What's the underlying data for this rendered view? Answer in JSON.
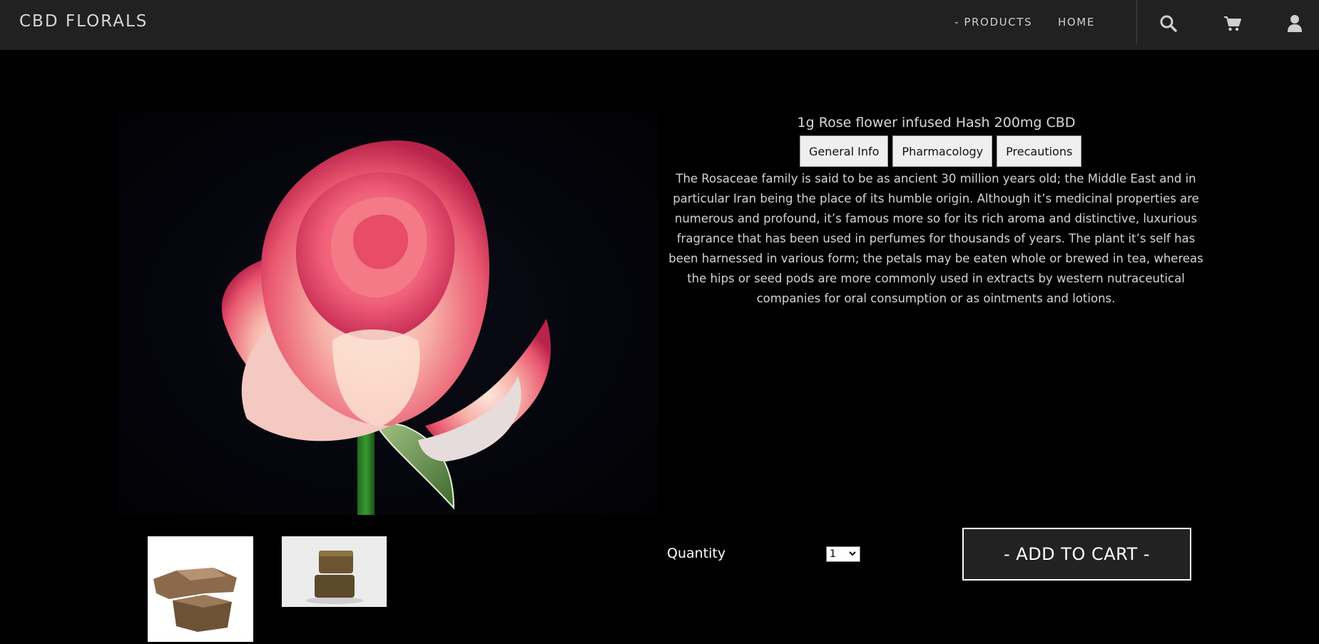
{
  "nav": {
    "brand": "CBD FLORALS",
    "products_label": "- PRODUCTS",
    "home_label": "HOME",
    "icons": [
      "search-icon",
      "cart-icon",
      "user-icon"
    ]
  },
  "product": {
    "title": "1g Rose flower infused Hash 200mg CBD",
    "tabs": [
      "General Info",
      "Pharmacology",
      "Precautions"
    ],
    "description": "The Rosaceae family is said to be as ancient 30 million years old; the Middle East and in particular Iran being the place of its humble origin. Although it’s medicinal properties are numerous and profound, it’s famous more so for its rich aroma and distinctive, luxurious fragrance that has been used in perfumes for thousands of years. The plant it’s self has been harnessed in various form; the petals may be eaten whole or brewed in tea, whereas the hips or seed pods are more commonly used in extracts by western nutraceutical companies for oral consumption or as ointments and lotions.",
    "quantity_label": "Quantity",
    "quantity_value": "1",
    "add_to_cart_label": "- ADD TO CART -"
  },
  "colors": {
    "navbar_bg": "#212121",
    "page_bg": "#000000",
    "button_bg": "#222222"
  }
}
